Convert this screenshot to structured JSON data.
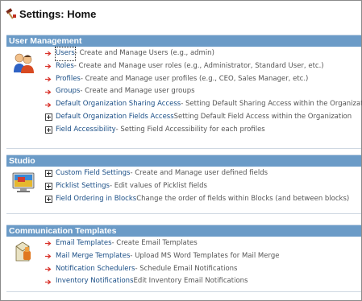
{
  "page": {
    "title": "Settings: Home"
  },
  "sections": [
    {
      "title": "User Management",
      "items": [
        {
          "label": "Users",
          "desc": " - Create and Manage Users (e.g., admin)",
          "marker": "arrow"
        },
        {
          "label": "Roles",
          "desc": " - Create and Manage user roles (e.g., Administrator, Standard User, etc.)",
          "marker": "arrow"
        },
        {
          "label": "Profiles",
          "desc": " - Create and Manage user profiles (e.g., CEO, Sales Manager, etc.)",
          "marker": "arrow"
        },
        {
          "label": "Groups",
          "desc": " - Create and Manage user groups",
          "marker": "arrow"
        },
        {
          "label": "Default Organization Sharing Access",
          "desc": " - Setting Default Sharing Access within the Organization",
          "marker": "arrow"
        },
        {
          "label": "Default Organization Fields Access",
          "desc": "Setting Default Field Access within the Organization",
          "marker": "plus"
        },
        {
          "label": "Field Accessibility",
          "desc": " - Setting Field Accessibility for each profiles",
          "marker": "plus"
        }
      ]
    },
    {
      "title": "Studio",
      "items": [
        {
          "label": "Custom Field Settings",
          "desc": " - Create and Manage user defined fields",
          "marker": "plus"
        },
        {
          "label": "Picklist Settings",
          "desc": " - Edit values of Picklist fields",
          "marker": "plus"
        },
        {
          "label": "Field Ordering in Blocks",
          "desc": " Change the order of fields within Blocks (and between blocks)",
          "marker": "plus"
        }
      ]
    },
    {
      "title": "Communication Templates",
      "items": [
        {
          "label": "Email Templates",
          "desc": " - Create Email Templates",
          "marker": "arrow"
        },
        {
          "label": "Mail Merge Templates",
          "desc": " - Upload MS Word Templates for Mail Merge",
          "marker": "arrow"
        },
        {
          "label": "Notification Schedulers",
          "desc": " - Schedule Email Notifications",
          "marker": "arrow"
        },
        {
          "label": "Inventory Notifications",
          "desc": " Edit Inventory Email Notifications",
          "marker": "arrow"
        }
      ]
    }
  ],
  "colors": {
    "header_bg": "#6b9bc7",
    "link": "#1a4e86",
    "arrow": "#d9332b"
  }
}
